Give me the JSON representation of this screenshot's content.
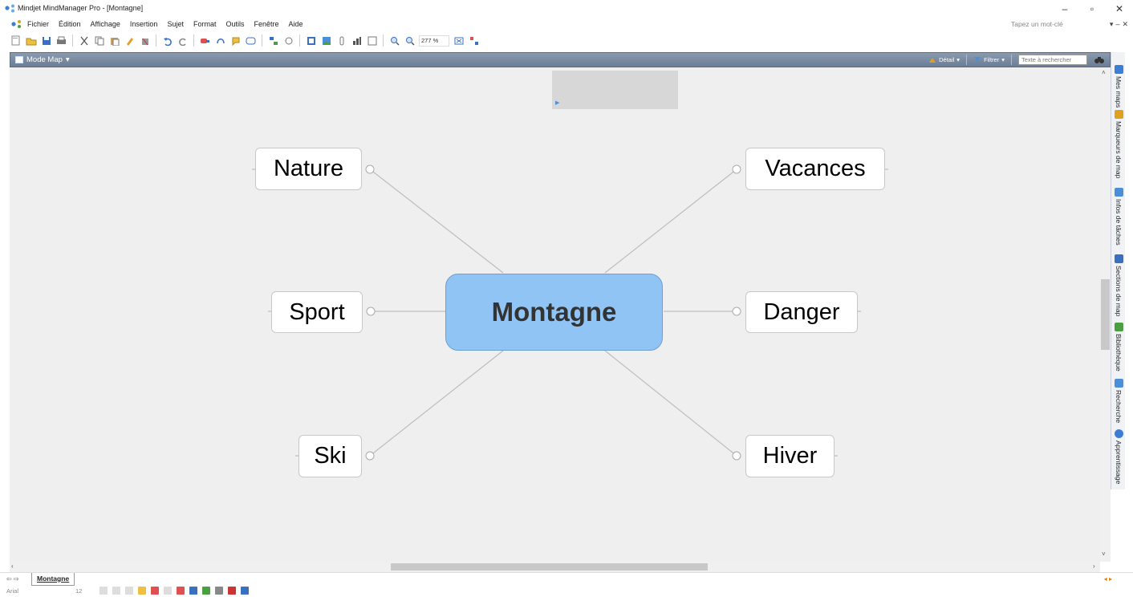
{
  "window": {
    "title": "Mindjet MindManager Pro - [Montagne]",
    "controls": [
      "–",
      "▫",
      "✕"
    ]
  },
  "menubar": {
    "items": [
      "Fichier",
      "Édition",
      "Affichage",
      "Insertion",
      "Sujet",
      "Format",
      "Outils",
      "Fenêtre",
      "Aide"
    ],
    "help_placeholder": "Tapez un mot-clé",
    "right": [
      "▾",
      "–",
      "✕"
    ]
  },
  "toolbar": {
    "zoom": "277 %"
  },
  "modebar": {
    "title": "Mode Map",
    "detail": "Détail",
    "filter": "Filtrer",
    "search_placeholder": "Texte à rechercher"
  },
  "map": {
    "central": "Montagne",
    "topics": {
      "nature": "Nature",
      "sport": "Sport",
      "ski": "Ski",
      "vacances": "Vacances",
      "danger": "Danger",
      "hiver": "Hiver"
    }
  },
  "taskpane": {
    "tabs": [
      {
        "label": "Mes maps",
        "icon": "maps-icon",
        "color": "#3a7fd5"
      },
      {
        "label": "Marqueurs de map",
        "icon": "markers-icon",
        "color": "#e0a020"
      },
      {
        "label": "Infos de tâches",
        "icon": "task-info-icon",
        "color": "#4a8fd8"
      },
      {
        "label": "Sections de map",
        "icon": "map-sections-icon",
        "color": "#3a70c0"
      },
      {
        "label": "Bibliothèque",
        "icon": "library-icon",
        "color": "#4aa040"
      },
      {
        "label": "Recherche",
        "icon": "search-icon",
        "color": "#4a8fd8"
      },
      {
        "label": "Apprentissage",
        "icon": "learning-icon",
        "color": "#3a7fd5"
      }
    ]
  },
  "sheetbar": {
    "nav": "⇦ ⇨",
    "tab": "Montagne",
    "right_nav": "◂ ▸"
  },
  "formatbar": {
    "font": "Arial",
    "size": "12"
  },
  "colors": {
    "central_fill": "#90c4f5",
    "canvas_bg": "#efefef",
    "modebar": "#7a8ca2"
  }
}
